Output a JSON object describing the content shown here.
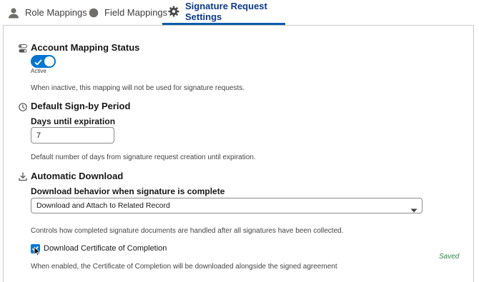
{
  "tabs": [
    {
      "label": "Role Mappings",
      "icon": "person-icon",
      "active": false
    },
    {
      "label": "Field Mappings",
      "icon": "circle-icon",
      "active": false
    },
    {
      "label": "Signature Request Settings",
      "icon": "gear-icon",
      "active": true
    }
  ],
  "account_mapping": {
    "title": "Account Mapping Status",
    "toggle_caption": "Active",
    "toggle_on": true,
    "help": "When inactive, this mapping will not be used for signature requests."
  },
  "sign_by": {
    "title": "Default Sign-by Period",
    "field_label": "Days until expiration",
    "field_value": "7",
    "help": "Default number of days from signature request creation until expiration."
  },
  "auto_download": {
    "title": "Automatic Download",
    "field_label": "Download behavior when signature is complete",
    "selected": "Download and Attach to Related Record",
    "help": "Controls how completed signature documents are handled after all signatures have been collected.",
    "checkbox_label": "Download Certificate of Completion",
    "checkbox_checked": true,
    "checkbox_help": "When enabled, the Certificate of Completion will be downloaded alongside the signed agreement"
  },
  "status": {
    "saved": "Saved"
  },
  "colors": {
    "accent": "#0176d3",
    "tab_active": "#0b3a8d",
    "saved": "#2e844a"
  }
}
